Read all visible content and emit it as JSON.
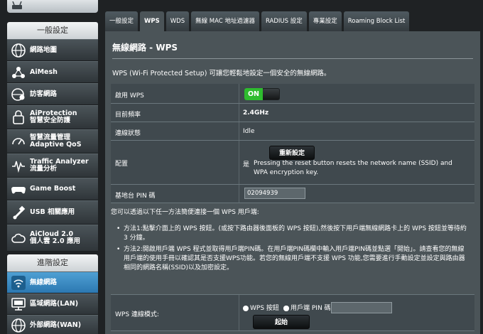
{
  "sidebar": {
    "general_section": "一般設定",
    "advanced_section": "進階設定",
    "general_items": [
      {
        "label": "網路地圖",
        "icon": "globe-icon"
      },
      {
        "label": "AiMesh",
        "icon": "mesh-icon"
      },
      {
        "label": "訪客網路",
        "icon": "guest-network-icon"
      },
      {
        "label": "AiProtection\n智慧安全防護",
        "icon": "lock-icon"
      },
      {
        "label": "智慧流量管理\nAdaptive QoS",
        "icon": "speedometer-icon"
      },
      {
        "label": "Traffic Analyzer\n流量分析",
        "icon": "traffic-icon"
      },
      {
        "label": "Game Boost",
        "icon": "gamepad-icon"
      },
      {
        "label": "USB 相關應用",
        "icon": "usb-icon"
      },
      {
        "label": "AiCloud 2.0\n個人雲 2.0 應用",
        "icon": "cloud-icon"
      }
    ],
    "advanced_items": [
      {
        "label": "無線網路",
        "icon": "wifi-icon",
        "active": true
      },
      {
        "label": "區域網路(LAN)",
        "icon": "monitor-icon",
        "active": false
      },
      {
        "label": "外部網路(WAN)",
        "icon": "globe-icon",
        "active": false
      }
    ]
  },
  "tabs": [
    "一般設定",
    "WPS",
    "WDS",
    "無線 MAC 地址過濾器",
    "RADIUS 設定",
    "專業設定",
    "Roaming Block List"
  ],
  "active_tab": "WPS",
  "page": {
    "title": "無線網路 - WPS",
    "intro": "WPS (Wi-Fi Protected Setup) 可讓您輕鬆地設定一個安全的無線網路。"
  },
  "settings": {
    "enable_wps_label": "啟用 WPS",
    "enable_wps_value": "ON",
    "frequency_label": "目前頻率",
    "frequency_value": "2.4GHz",
    "status_label": "連線狀態",
    "status_value": "Idle",
    "config_label": "配置",
    "config_value": "是",
    "reset_button": "重新設定",
    "reset_warning": "Pressing the reset button resets the network name (SSID) and WPA encryption key.",
    "pin_label": "基地台 PIN 碼",
    "pin_value": "02094939"
  },
  "help": {
    "lead": "您可以透過以下任一方法簡便連接一個 WPS 用戶端:",
    "bullets": [
      "方法1:點擊介面上的 WPS 按鈕。(或按下路由器後面板的 WPS 按鈕),然後按下用戶端無線網路卡上的 WPS 按鈕並等待約 3 分鐘。",
      "方法2:開啟用戶端 WPS 程式並取得用戶端PIN碼。在用戶端PIN碼欄中輸入用戶端PIN碼並點選「開始」。請查看您的無線用戶端的使用手冊以確認其是否支援WPS功能。若您的無線用戶端不支援 WPS 功能,您需要進行手動設定並設定與路由器相同的網路名稱(SSID)以及加密設定。"
    ]
  },
  "connect": {
    "label": "WPS 連線模式:",
    "option_button": "WPS 按鈕",
    "option_pin": "用戶端 PIN 碼",
    "start_button": "起始"
  }
}
